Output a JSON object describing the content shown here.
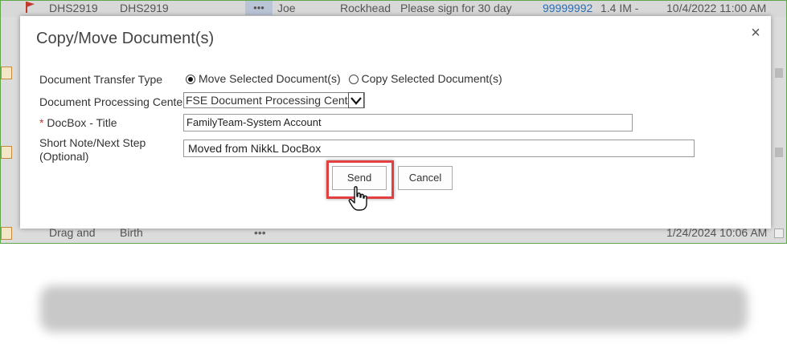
{
  "background_rows": {
    "top": {
      "col1": "DHS2919",
      "col2": "DHS2919",
      "ellipsis": "•••",
      "first_name": "Joe",
      "last_name": "Rockhead",
      "note": "Please sign for 30 day",
      "case_number": "99999992",
      "size": "1.4 IM -",
      "modified": "10/4/2022 11:00 AM"
    },
    "bottom": {
      "col1": "Drag and",
      "col2": "Birth",
      "ellipsis": "•••",
      "modified": "1/24/2024 10:06 AM"
    }
  },
  "dialog": {
    "title": "Copy/Move Document(s)",
    "close_glyph": "×",
    "fields": {
      "transfer_type_label": "Document Transfer Type",
      "move_option": "Move Selected Document(s)",
      "copy_option": "Copy Selected Document(s)",
      "selected_option": "move",
      "processing_center_label": "Document Processing Center",
      "processing_center_value": "FSE Document Processing Center",
      "required_marker": "*",
      "docbox_title_label": "DocBox - Title",
      "docbox_title_value": "FamilyTeam-System Account",
      "note_label_line1": "Short Note/Next Step",
      "note_label_line2": "(Optional)",
      "note_value": "Moved from NikkL DocBox"
    },
    "buttons": {
      "send": "Send",
      "cancel": "Cancel"
    }
  },
  "colors": {
    "frame_border": "#5fa84a",
    "highlight": "#e04040",
    "link": "#2a6db5",
    "required": "#c0392b"
  },
  "icons": [
    "flag-icon",
    "document-icon",
    "close-icon",
    "chevron-down-icon",
    "hand-pointer-icon"
  ]
}
